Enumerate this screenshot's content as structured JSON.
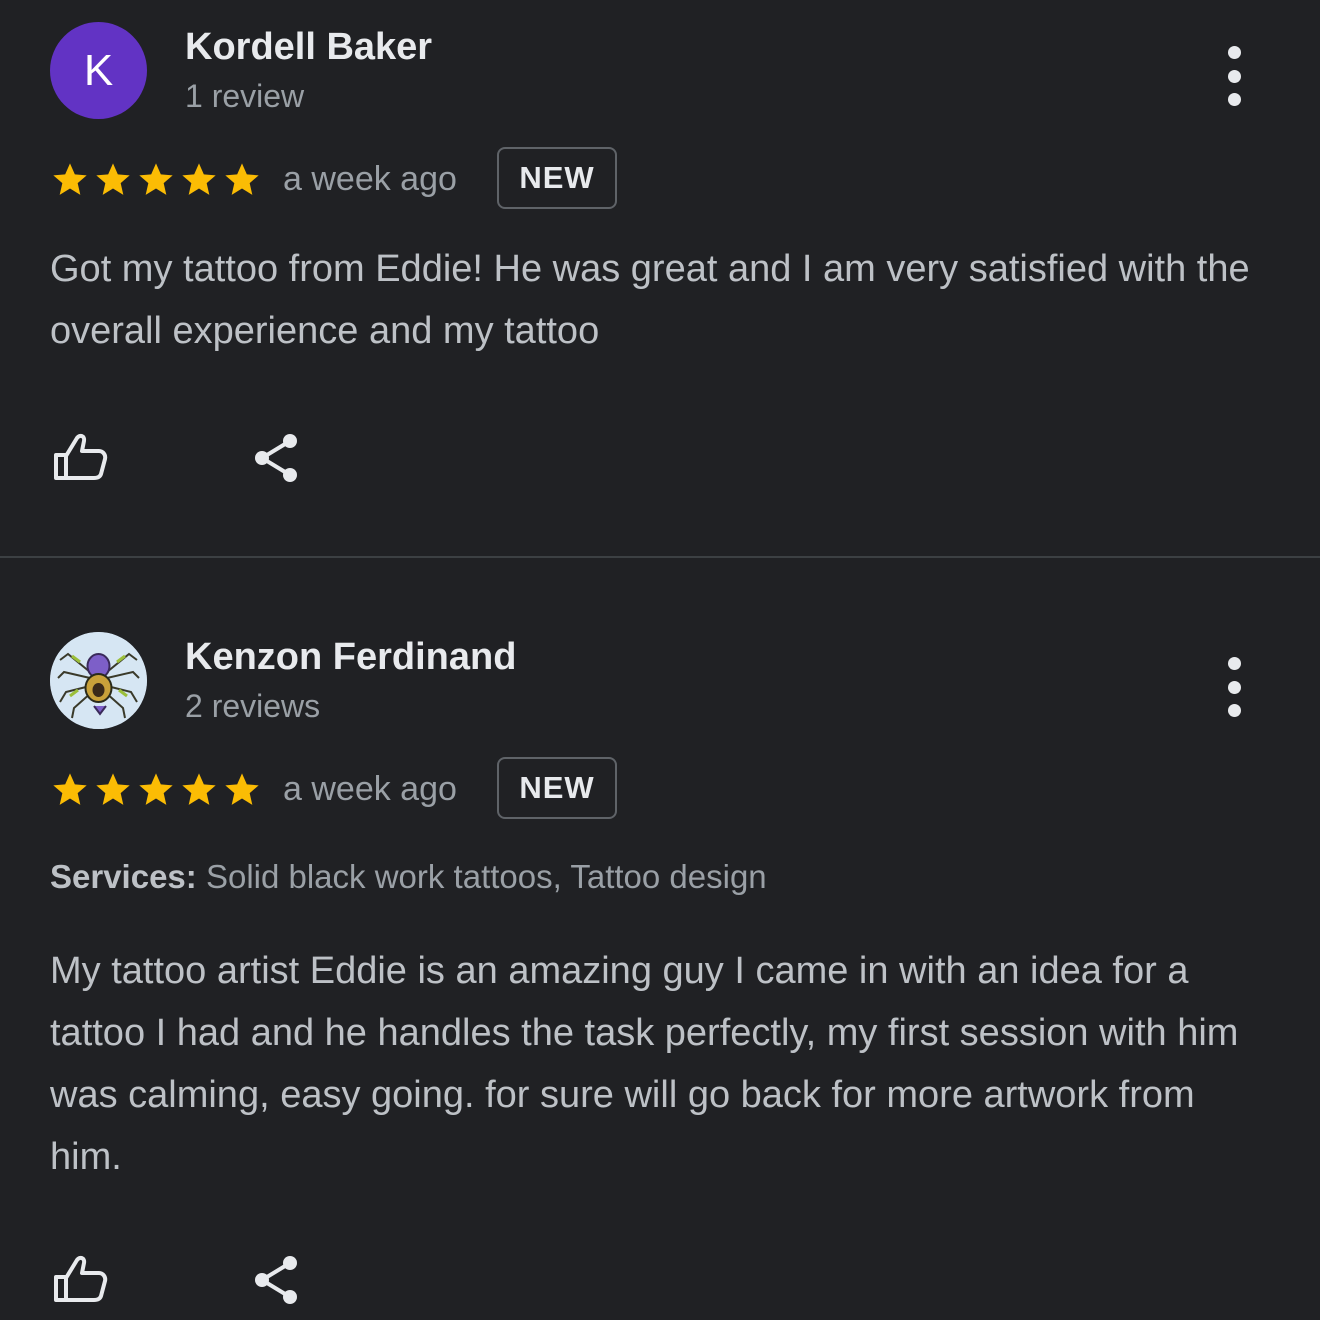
{
  "reviews": [
    {
      "name": "Kordell Baker",
      "review_count": "1 review",
      "avatar_letter": "K",
      "avatar_color": "#6233c4",
      "rating": 5,
      "max_rating": 5,
      "time": "a week ago",
      "badge": "NEW",
      "text": "Got my tattoo from Eddie! He was great and I am very satisfied with the overall experience and my tattoo"
    },
    {
      "name": "Kenzon Ferdinand",
      "review_count": "2 reviews",
      "avatar_image": "spider-drawing-avatar",
      "rating": 5,
      "max_rating": 5,
      "time": "a week ago",
      "badge": "NEW",
      "services_label": "Services:",
      "services_value": "Solid black work tattoos, Tattoo design",
      "text": "My tattoo artist Eddie is an amazing guy I came in with an idea for a tattoo I had and he handles the task perfectly, my first session with him was calming, easy going. for sure will go back for more artwork from him."
    }
  ],
  "icons": {
    "more": "more-vertical-icon",
    "like": "thumbs-up-icon",
    "share": "share-icon",
    "star": "star-icon"
  },
  "colors": {
    "background": "#202124",
    "star": "#fbbc04",
    "text_primary": "#e8eaed",
    "text_secondary": "#9aa0a6"
  }
}
